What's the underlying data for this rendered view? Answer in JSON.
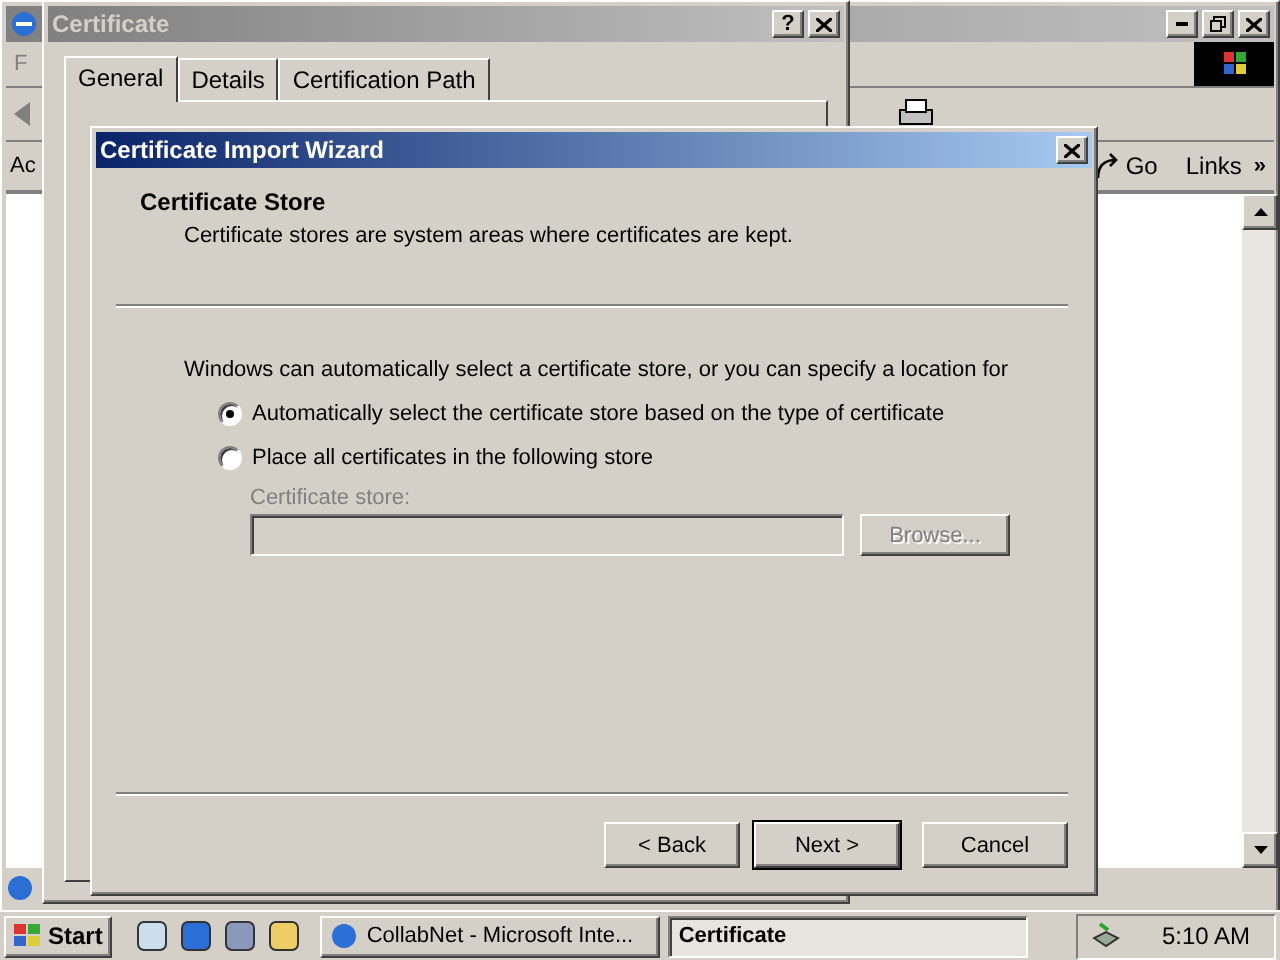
{
  "browser": {
    "menu_letter": "F",
    "address_label": "Ac",
    "go_button": "Go",
    "links_label": "Links",
    "links_chevron": "»"
  },
  "certificate_dialog": {
    "title": "Certificate",
    "active": false,
    "help_button": "?",
    "tabs": [
      {
        "label": "General",
        "selected": true
      },
      {
        "label": "Details",
        "selected": false
      },
      {
        "label": "Certification Path",
        "selected": false
      }
    ]
  },
  "wizard": {
    "title": "Certificate Import Wizard",
    "active": true,
    "heading": "Certificate Store",
    "subheading": "Certificate stores are system areas where certificates are kept.",
    "intro": "Windows can automatically select a certificate store, or you can specify a location for",
    "options": [
      {
        "label": "Automatically select the certificate store based on the type of certificate",
        "selected": true
      },
      {
        "label": "Place all certificates in the following store",
        "selected": false
      }
    ],
    "store_label": "Certificate store:",
    "store_disabled": true,
    "browse_button": "Browse...",
    "buttons": [
      {
        "label": "< Back",
        "default": false
      },
      {
        "label": "Next >",
        "default": true
      },
      {
        "label": "Cancel",
        "default": false
      }
    ]
  },
  "taskbar": {
    "start": "Start",
    "tasks": [
      {
        "label": "CollabNet - Microsoft Inte...",
        "selected": false
      },
      {
        "label": "Certificate",
        "selected": true
      }
    ],
    "clock": "5:10 AM"
  }
}
